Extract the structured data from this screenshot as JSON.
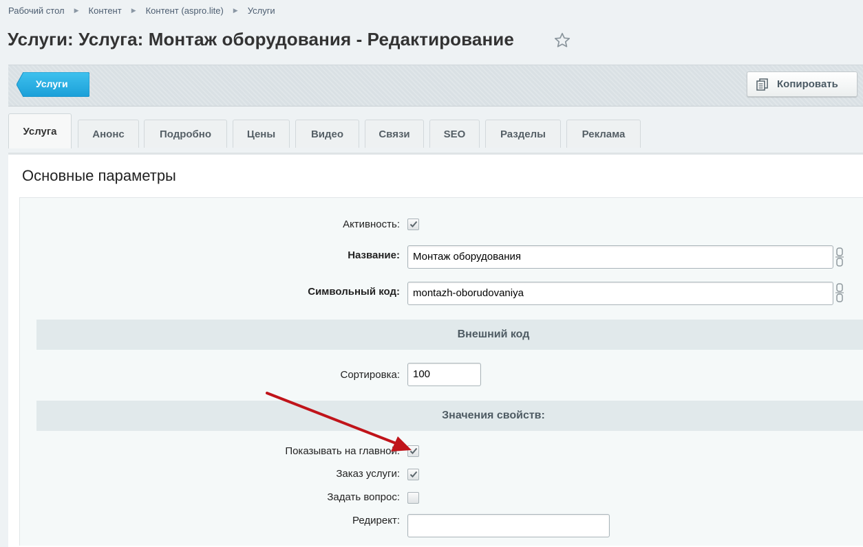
{
  "breadcrumb": [
    "Рабочий стол",
    "Контент",
    "Контент (aspro.lite)",
    "Услуги"
  ],
  "page_title": "Услуги: Услуга: Монтаж оборудования - Редактирование",
  "toolbar": {
    "back_label": "Услуги",
    "copy_label": "Копировать"
  },
  "tabs": [
    "Услуга",
    "Анонс",
    "Подробно",
    "Цены",
    "Видео",
    "Связи",
    "SEO",
    "Разделы",
    "Реклама"
  ],
  "section_title": "Основные параметры",
  "fields": {
    "active_label": "Активность:",
    "active_checked": true,
    "name_label": "Название:",
    "name_value": "Монтаж оборудования",
    "code_label": "Символьный код:",
    "code_value": "montazh-oborudovaniya",
    "external_code_header": "Внешний код",
    "sort_label": "Сортировка:",
    "sort_value": "100",
    "properties_header": "Значения свойств:",
    "show_main_label": "Показывать на главной:",
    "show_main_checked": true,
    "order_label": "Заказ услуги:",
    "order_checked": true,
    "question_label": "Задать вопрос:",
    "question_checked": false,
    "redirect_label": "Редирект:",
    "redirect_value": ""
  },
  "colors": {
    "accent_blue": "#1fa7dd",
    "annotation_arrow": "#c0141a"
  }
}
